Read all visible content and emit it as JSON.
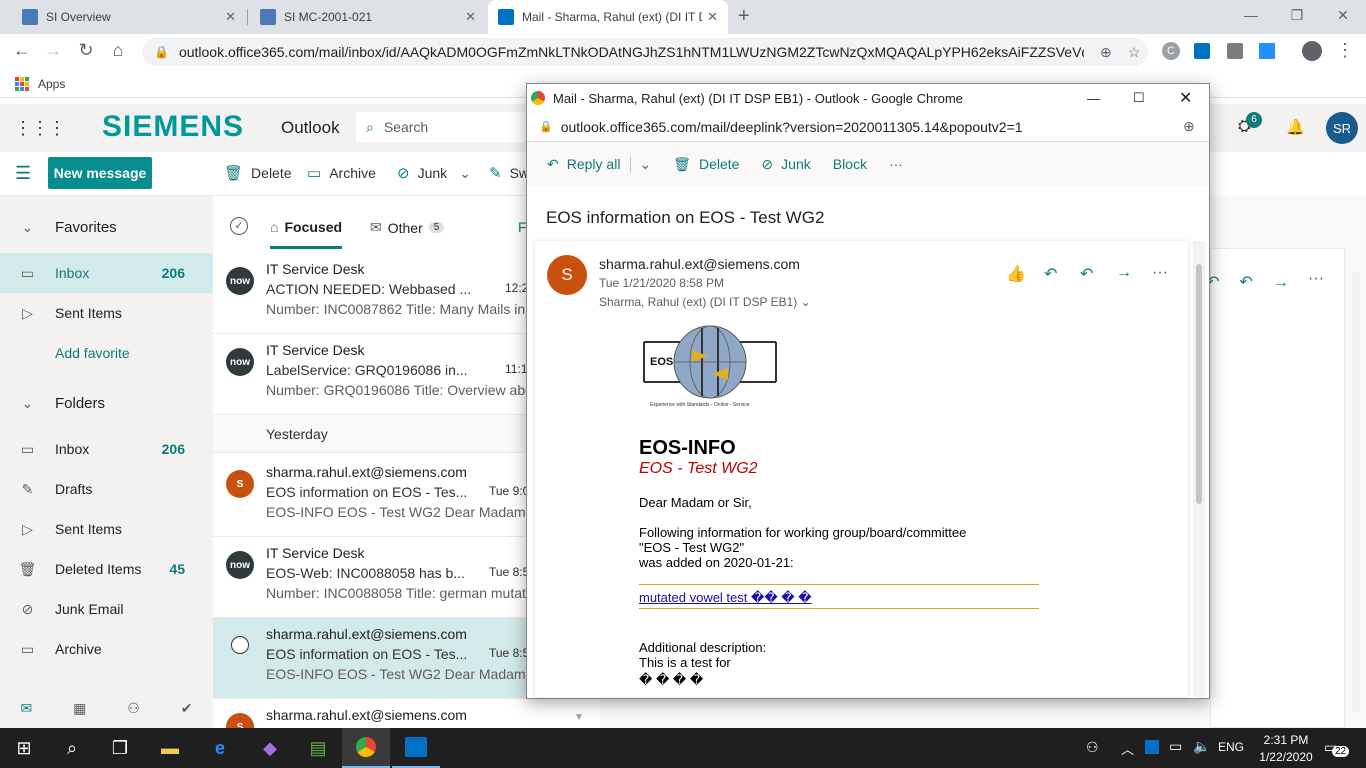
{
  "browser": {
    "tabs": [
      {
        "title": "SI Overview"
      },
      {
        "title": "SI MC-2001-021"
      },
      {
        "title": "Mail - Sharma, Rahul (ext) (DI IT D"
      }
    ],
    "url": "outlook.office365.com/mail/inbox/id/AAQkADM0OGFmZmNkLTNkODAtNGJhZS1hNTM1LWUzNGM2ZTcwNzQxMQAQALpYPH62eksAiFZZSVeVq...",
    "bookmarks_label": "Apps",
    "profile_initial": "C"
  },
  "outlook": {
    "brand": "SIEMENS",
    "app_name": "Outlook",
    "search_placeholder": "Search",
    "notification_count": "6",
    "user_initials": "SR",
    "commands": {
      "new_message": "New message",
      "delete": "Delete",
      "archive": "Archive",
      "junk": "Junk",
      "sweep": "Sw"
    },
    "nav": {
      "favorites": "Favorites",
      "fav_inbox": "Inbox",
      "fav_inbox_count": "206",
      "fav_sent": "Sent Items",
      "add_favorite": "Add favorite",
      "folders": "Folders",
      "inbox": "Inbox",
      "inbox_count": "206",
      "drafts": "Drafts",
      "sent": "Sent Items",
      "deleted": "Deleted Items",
      "deleted_count": "45",
      "junk": "Junk Email",
      "archive": "Archive"
    },
    "list": {
      "tab_focused": "Focused",
      "tab_other": "Other",
      "other_count": "5",
      "filter": "F",
      "group_yesterday": "Yesterday",
      "messages": [
        {
          "from": "IT Service Desk",
          "subject": "ACTION NEEDED: Webbased ...",
          "date": "12:2",
          "preview": "Number: INC0087862 Title: Many Mails in",
          "avatar": "now"
        },
        {
          "from": "IT Service Desk",
          "subject": "LabelService: GRQ0196086 in...",
          "date": "11:1",
          "preview": "Number: GRQ0196086 Title: Overview abo",
          "avatar": "now"
        },
        {
          "from": "sharma.rahul.ext@siemens.com",
          "subject": "EOS information on EOS - Tes...",
          "date": "Tue 9:0",
          "preview": "EOS-INFO EOS - Test WG2 Dear Madam o",
          "avatar": "S"
        },
        {
          "from": "IT Service Desk",
          "subject": "EOS-Web: INC0088058 has b...",
          "date": "Tue 8:5",
          "preview": "Number: INC0088058 Title: german mutat",
          "avatar": "now"
        },
        {
          "from": "sharma.rahul.ext@siemens.com",
          "subject": "EOS information on EOS - Tes...",
          "date": "Tue 8:5",
          "preview": "EOS-INFO EOS - Test WG2 Dear Madam o",
          "avatar": "S"
        },
        {
          "from": "sharma.rahul.ext@siemens.com",
          "subject": "",
          "date": "",
          "preview": "",
          "avatar": "S"
        }
      ]
    }
  },
  "popup": {
    "window_title": "Mail - Sharma, Rahul (ext) (DI IT DSP EB1) - Outlook - Google Chrome",
    "url": "outlook.office365.com/mail/deeplink?version=2020011305.14&popoutv2=1",
    "commands": {
      "reply_all": "Reply all",
      "delete": "Delete",
      "junk": "Junk",
      "block": "Block",
      "more": "···"
    },
    "subject": "EOS information on EOS - Test WG2",
    "sender_initial": "S",
    "sender": "sharma.rahul.ext@siemens.com",
    "date": "Tue 1/21/2020 8:58 PM",
    "to": "Sharma, Rahul (ext) (DI IT DSP EB1)",
    "body": {
      "logo_text": "EOS",
      "logo_caption": "Experience with Standards - Online - Service",
      "heading": "EOS-INFO",
      "subheading": "EOS - Test WG2",
      "greeting": "Dear Madam or Sir,",
      "line1": "Following information for working group/board/committee",
      "line2": "\"EOS - Test WG2\"",
      "line3": "was added on 2020-01-21:",
      "link": "mutated vowel test �� � �",
      "addl_label": "Additional description:",
      "addl_text": "This is a test for",
      "addl_chars": "� � � �"
    }
  },
  "taskbar": {
    "language": "ENG",
    "time": "2:31 PM",
    "date": "1/22/2020",
    "notif_count": "22"
  }
}
